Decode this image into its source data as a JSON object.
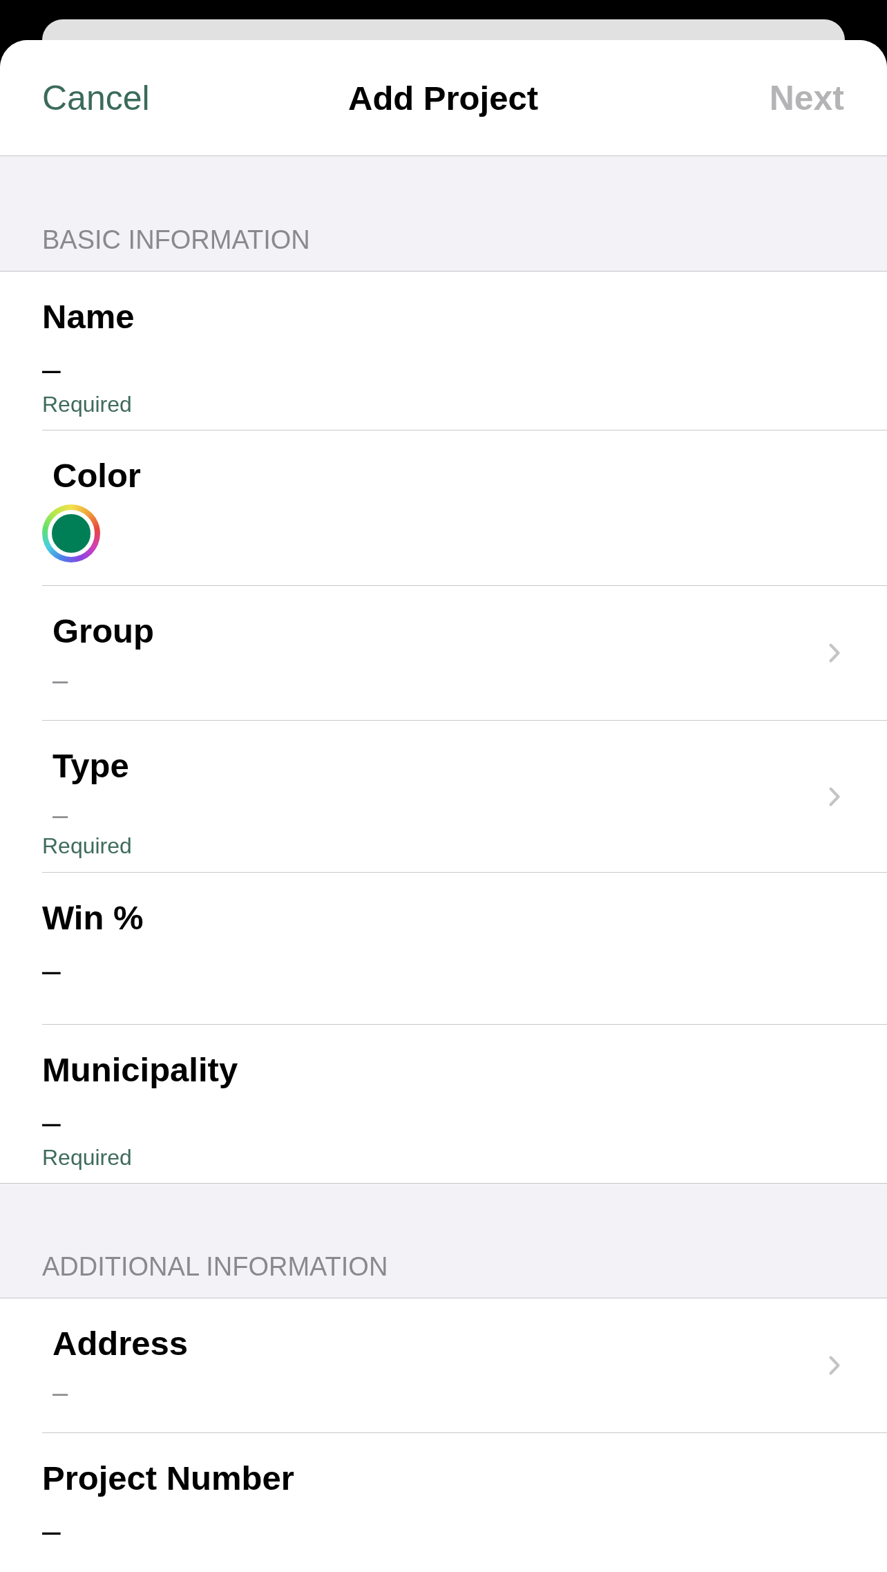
{
  "navigation_bar": {
    "cancel": "Cancel",
    "title": "Add Project",
    "next": {
      "label": "Next",
      "disabled": true
    }
  },
  "sections": [
    {
      "header": "BASIC INFORMATION",
      "fields": [
        {
          "kind": "text",
          "label": "Name",
          "value": "–",
          "hint": "Required"
        },
        {
          "kind": "color",
          "label": "Color",
          "color": "#007f56"
        },
        {
          "kind": "picker",
          "label": "Group",
          "placeholder": "–"
        },
        {
          "kind": "picker",
          "label": "Type",
          "placeholder": "–",
          "hint": "Required"
        },
        {
          "kind": "text",
          "label": "Win %",
          "value": "–"
        },
        {
          "kind": "text",
          "label": "Municipality",
          "value": "–",
          "hint": "Required"
        }
      ]
    },
    {
      "header": "ADDITIONAL INFORMATION",
      "fields": [
        {
          "kind": "picker",
          "label": "Address",
          "placeholder": "–"
        },
        {
          "kind": "text",
          "label": "Project Number",
          "value": "–"
        }
      ]
    }
  ]
}
